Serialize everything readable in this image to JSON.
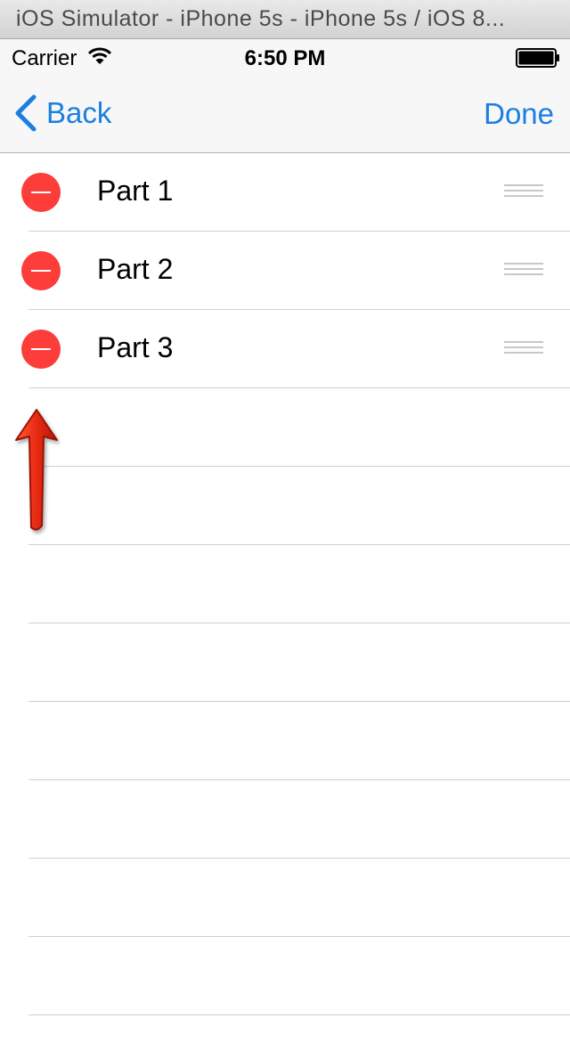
{
  "window": {
    "title": "iOS Simulator - iPhone 5s - iPhone 5s / iOS 8..."
  },
  "status_bar": {
    "carrier": "Carrier",
    "time": "6:50 PM",
    "icons": [
      "wifi-icon",
      "battery-icon"
    ]
  },
  "nav": {
    "back_label": "Back",
    "done_label": "Done",
    "tint_color": "#1a7fe0"
  },
  "table": {
    "rows": [
      {
        "label": "Part 1"
      },
      {
        "label": "Part 2"
      },
      {
        "label": "Part 3"
      }
    ],
    "delete_color": "#fc3d39"
  },
  "annotation": {
    "icon": "red-arrow-up-icon"
  }
}
